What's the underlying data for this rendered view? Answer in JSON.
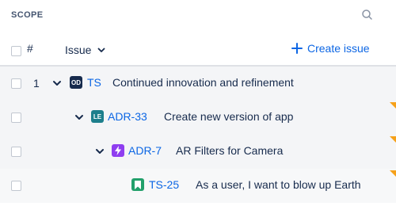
{
  "scope": {
    "title": "SCOPE",
    "search_icon": "search-icon"
  },
  "columns": {
    "number": "#",
    "issue": "Issue",
    "create": "Create issue"
  },
  "colors": {
    "accent": "#ffa629",
    "link": "#0c66e4"
  },
  "rows": [
    {
      "num": "1",
      "type_icon": "od-project-icon",
      "type_label": "OD",
      "key": "TS",
      "summary": "Continued innovation and refinement",
      "expanded": true
    },
    {
      "num": "",
      "type_icon": "le-project-icon",
      "type_label": "LE",
      "key": "ADR-33",
      "summary": "Create new version of app",
      "expanded": true
    },
    {
      "num": "",
      "type_icon": "epic-icon",
      "type_label": "",
      "key": "ADR-7",
      "summary": "AR Filters for Camera",
      "expanded": true
    },
    {
      "num": "",
      "type_icon": "story-icon",
      "type_label": "",
      "key": "TS-25",
      "summary": "As a user, I want to blow up Earth",
      "expanded": false
    }
  ]
}
